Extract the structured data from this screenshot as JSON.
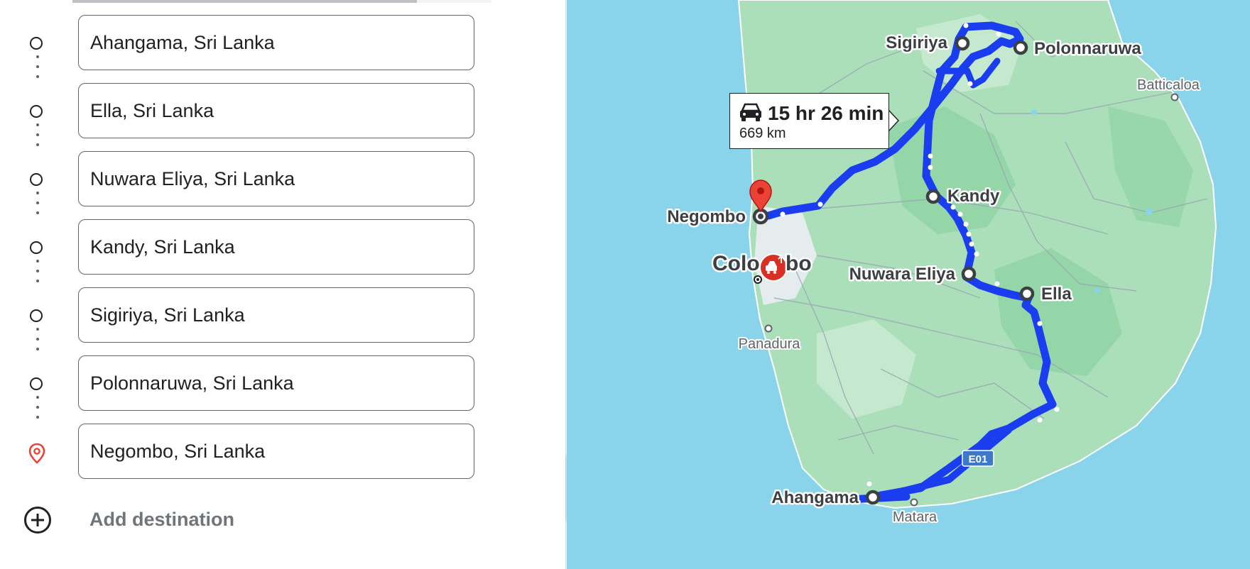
{
  "directions": {
    "stops": [
      {
        "value": "Ahangama, Sri Lanka",
        "type": "waypoint"
      },
      {
        "value": "Ella, Sri Lanka",
        "type": "waypoint"
      },
      {
        "value": "Nuwara Eliya, Sri Lanka",
        "type": "waypoint"
      },
      {
        "value": "Kandy, Sri Lanka",
        "type": "waypoint"
      },
      {
        "value": "Sigiriya, Sri Lanka",
        "type": "waypoint"
      },
      {
        "value": "Polonnaruwa, Sri Lanka",
        "type": "waypoint"
      },
      {
        "value": "Negombo, Sri Lanka",
        "type": "destination"
      }
    ],
    "add_destination_label": "Add destination"
  },
  "map": {
    "route": {
      "duration": "15 hr 26 min",
      "distance": "669 km",
      "mode_icon": "car-icon"
    },
    "labels": {
      "sigiriya": "Sigiriya",
      "polonnaruwa": "Polonnaruwa",
      "batticaloa": "Batticaloa",
      "kandy": "Kandy",
      "negombo": "Negombo",
      "colombo": "Colo",
      "colombo2": "bo",
      "nuwara_eliya": "Nuwara Eliya",
      "ella": "Ella",
      "panadura": "Panadura",
      "ahangama": "Ahangama",
      "matara": "Matara",
      "highway": "E01"
    },
    "colors": {
      "water": "#8ad4eb",
      "land": "#aadfb9",
      "land_green": "#c8ead0",
      "route": "#1a3df0",
      "pin": "#ea4335"
    }
  }
}
